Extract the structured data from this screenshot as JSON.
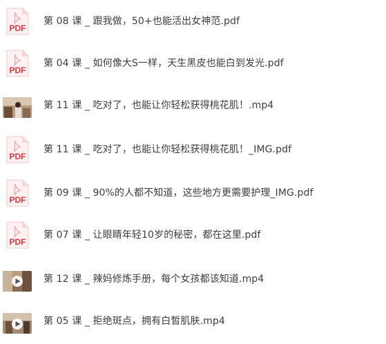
{
  "files": [
    {
      "name": "第 08 课 _ 跟我做，50+也能活出女神范.pdf",
      "type": "pdf",
      "icon": "pdf-file-icon",
      "icon_label": "PDF"
    },
    {
      "name": "第 04 课 _ 如何像大S一样，天生黑皮也能白到发光.pdf",
      "type": "pdf",
      "icon": "pdf-file-icon",
      "icon_label": "PDF"
    },
    {
      "name": "第 11 课 _ 吃对了，也能让你轻松获得桃花肌！.mp4",
      "type": "mp4",
      "icon": "video-thumbnail"
    },
    {
      "name": "第 11 课 _ 吃对了，也能让你轻松获得桃花肌！_IMG.pdf",
      "type": "pdf",
      "icon": "pdf-file-icon",
      "icon_label": "PDF"
    },
    {
      "name": "第 09 课 _ 90%的人都不知道，这些地方更需要护理_IMG.pdf",
      "type": "pdf",
      "icon": "pdf-file-icon",
      "icon_label": "PDF"
    },
    {
      "name": "第 07 课 _ 让眼睛年轻10岁的秘密，都在这里.pdf",
      "type": "pdf",
      "icon": "pdf-file-icon",
      "icon_label": "PDF"
    },
    {
      "name": "第 12 课 _ 辣妈修炼手册，每个女孩都该知道.mp4",
      "type": "mp4",
      "icon": "video-thumbnail"
    },
    {
      "name": "第 05 课 _ 拒绝斑点，拥有白皙肌肤.mp4",
      "type": "mp4",
      "icon": "video-thumbnail"
    }
  ],
  "colors": {
    "pdf_red": "#e0353f",
    "pdf_page": "#fdf1f1",
    "text": "#3d3d3d"
  }
}
